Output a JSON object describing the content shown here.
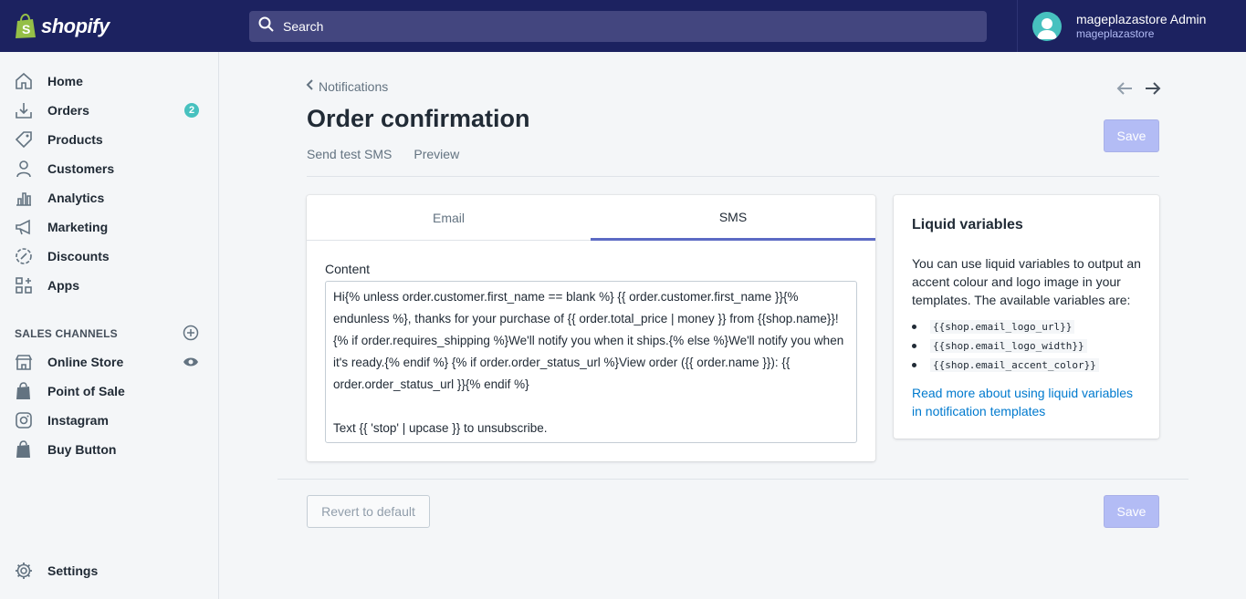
{
  "brand": {
    "name": "shopify",
    "accent": "#5c6ac4",
    "topbar_color": "#1c2260"
  },
  "search": {
    "placeholder": "Search"
  },
  "user": {
    "name": "mageplazastore Admin",
    "store": "mageplazastore"
  },
  "sidebar": {
    "items": [
      {
        "label": "Home",
        "icon": "home-icon"
      },
      {
        "label": "Orders",
        "icon": "orders-icon",
        "badge": "2"
      },
      {
        "label": "Products",
        "icon": "tag-icon"
      },
      {
        "label": "Customers",
        "icon": "customer-icon"
      },
      {
        "label": "Analytics",
        "icon": "analytics-icon"
      },
      {
        "label": "Marketing",
        "icon": "megaphone-icon"
      },
      {
        "label": "Discounts",
        "icon": "discount-icon"
      },
      {
        "label": "Apps",
        "icon": "apps-icon"
      }
    ],
    "sales_channels_heading": "SALES CHANNELS",
    "channels": [
      {
        "label": "Online Store",
        "icon": "store-icon"
      },
      {
        "label": "Point of Sale",
        "icon": "shopify-bag-icon"
      },
      {
        "label": "Instagram",
        "icon": "instagram-icon"
      },
      {
        "label": "Buy Button",
        "icon": "shopify-bag-icon"
      }
    ],
    "settings": {
      "label": "Settings",
      "icon": "gear-icon"
    }
  },
  "page": {
    "breadcrumb": "Notifications",
    "title": "Order confirmation",
    "actions": [
      "Send test SMS",
      "Preview"
    ],
    "save_label": "Save",
    "revert_label": "Revert to default"
  },
  "editor": {
    "tabs": [
      "Email",
      "SMS"
    ],
    "active_tab": "SMS",
    "content_label": "Content",
    "content": "Hi{% unless order.customer.first_name == blank %} {{ order.customer.first_name }}{% endunless %}, thanks for your purchase of {{ order.total_price | money }} from {{shop.name}}! {% if order.requires_shipping %}We'll notify you when it ships.{% else %}We'll notify you when it's ready.{% endif %} {% if order.order_status_url %}View order ({{ order.name }}): {{ order.order_status_url }}{% endif %}\n\nText {{ 'stop' | upcase }} to unsubscribe."
  },
  "liquid": {
    "title": "Liquid variables",
    "description": "You can use liquid variables to output an accent colour and logo image in your templates. The available variables are:",
    "variables": [
      "{{shop.email_logo_url}}",
      "{{shop.email_logo_width}}",
      "{{shop.email_accent_color}}"
    ],
    "link": "Read more about using liquid variables in notification templates"
  }
}
